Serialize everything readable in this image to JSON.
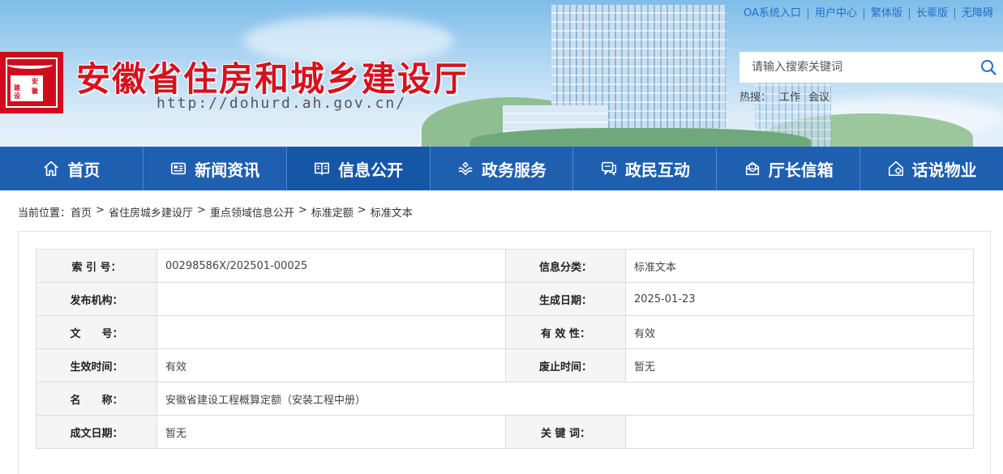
{
  "site": {
    "title": "安徽省住房和城乡建设厅",
    "url": "http://dohurd.ah.gov.cn/",
    "logo_text": [
      "安",
      "徽",
      "建",
      "设"
    ]
  },
  "top_links": [
    "OA系统入口",
    "用户中心",
    "繁体版",
    "长辈版",
    "无障碍"
  ],
  "search": {
    "placeholder": "请输入搜索关键词",
    "hot_label": "热搜：",
    "hot_terms": [
      "工作",
      "会议"
    ]
  },
  "nav": [
    {
      "label": "首页",
      "icon": "home-icon"
    },
    {
      "label": "新闻资讯",
      "icon": "news-icon"
    },
    {
      "label": "信息公开",
      "icon": "book-icon",
      "active": true
    },
    {
      "label": "政务服务",
      "icon": "service-icon"
    },
    {
      "label": "政民互动",
      "icon": "chat-icon"
    },
    {
      "label": "厅长信箱",
      "icon": "mailbox-icon"
    },
    {
      "label": "话说物业",
      "icon": "property-icon"
    }
  ],
  "breadcrumb": {
    "prefix": "当前位置：",
    "items": [
      "首页",
      "省住房城乡建设厅",
      "重点领域信息公开",
      "标准定额",
      "标准文本"
    ],
    "separator": ">"
  },
  "info": {
    "index_no_label": "索 引 号：",
    "index_no": "00298586X/202501-00025",
    "category_label": "信息分类：",
    "category": "标准文本",
    "publisher_label": "发布机构：",
    "publisher": "",
    "created_label": "生成日期：",
    "created": "2025-01-23",
    "doc_no_label": "文　　号：",
    "doc_no": "",
    "validity_label": "有 效 性：",
    "validity": "有效",
    "effective_label": "生效时间：",
    "effective": "有效",
    "abolish_label": "废止时间：",
    "abolish": "暂无",
    "name_label": "名　　称：",
    "name": "安徽省建设工程概算定额（安装工程中册）",
    "written_label": "成文日期：",
    "written": "暂无",
    "keywords_label": "关 键 词：",
    "keywords": ""
  },
  "colors": {
    "brand_red": "#d6121f",
    "nav_blue": "#1f5fb0",
    "link_blue": "#1f6fc5"
  }
}
